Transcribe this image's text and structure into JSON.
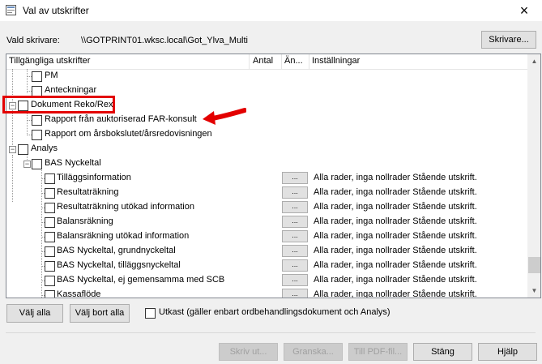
{
  "window": {
    "title": "Val av utskrifter",
    "close_glyph": "×"
  },
  "printer": {
    "label": "Vald skrivare:",
    "value": "\\\\GOTPRINT01.wksc.local\\Got_Ylva_Multi",
    "button_label": "Skrivare..."
  },
  "columns": [
    "Tillgängliga utskrifter",
    "Antal",
    "Än...",
    "Inställningar"
  ],
  "tree": [
    {
      "label": "PM"
    },
    {
      "label": "Anteckningar"
    },
    {
      "label": "Dokument Reko/Rex"
    },
    {
      "label": "Rapport från auktoriserad FAR-konsult"
    },
    {
      "label": "Rapport om årsbokslutet/årsredovisningen"
    },
    {
      "label": "Analys"
    },
    {
      "label": "BAS Nyckeltal"
    },
    {
      "label": "Tilläggsinformation",
      "dots": "...",
      "setting": "Alla rader, inga nollrader Stående utskrift."
    },
    {
      "label": "Resultaträkning",
      "dots": "...",
      "setting": "Alla rader, inga nollrader Stående utskrift."
    },
    {
      "label": "Resultaträkning utökad information",
      "dots": "...",
      "setting": "Alla rader, inga nollrader Stående utskrift."
    },
    {
      "label": "Balansräkning",
      "dots": "...",
      "setting": "Alla rader, inga nollrader Stående utskrift."
    },
    {
      "label": "Balansräkning utökad information",
      "dots": "...",
      "setting": "Alla rader, inga nollrader Stående utskrift."
    },
    {
      "label": "BAS Nyckeltal, grundnyckeltal",
      "dots": "...",
      "setting": "Alla rader, inga nollrader Stående utskrift."
    },
    {
      "label": "BAS Nyckeltal, tilläggsnyckeltal",
      "dots": "...",
      "setting": "Alla rader, inga nollrader Stående utskrift."
    },
    {
      "label": "BAS Nyckeltal, ej gemensamma med SCB",
      "dots": "...",
      "setting": "Alla rader, inga nollrader Stående utskrift."
    },
    {
      "label": "Kassaflöde",
      "dots": "...",
      "setting": "Alla rader, inga nollrader Stående utskrift."
    }
  ],
  "buttons": {
    "select_all": "Välj alla",
    "deselect_all": "Välj bort alla",
    "draft_label": "Utkast (gäller enbart ordbehandlingsdokument och Analys)",
    "print": "Skriv ut...",
    "preview": "Granska...",
    "pdf": "Till PDF-fil...",
    "close": "Stäng",
    "help": "Hjälp"
  },
  "colors": {
    "highlight": "#e30000",
    "arrow": "#e30000"
  },
  "icons": [
    "app-icon",
    "close-icon",
    "scroll-up-icon",
    "scroll-down-icon",
    "expand-icon",
    "collapse-icon",
    "red-arrow-icon"
  ]
}
